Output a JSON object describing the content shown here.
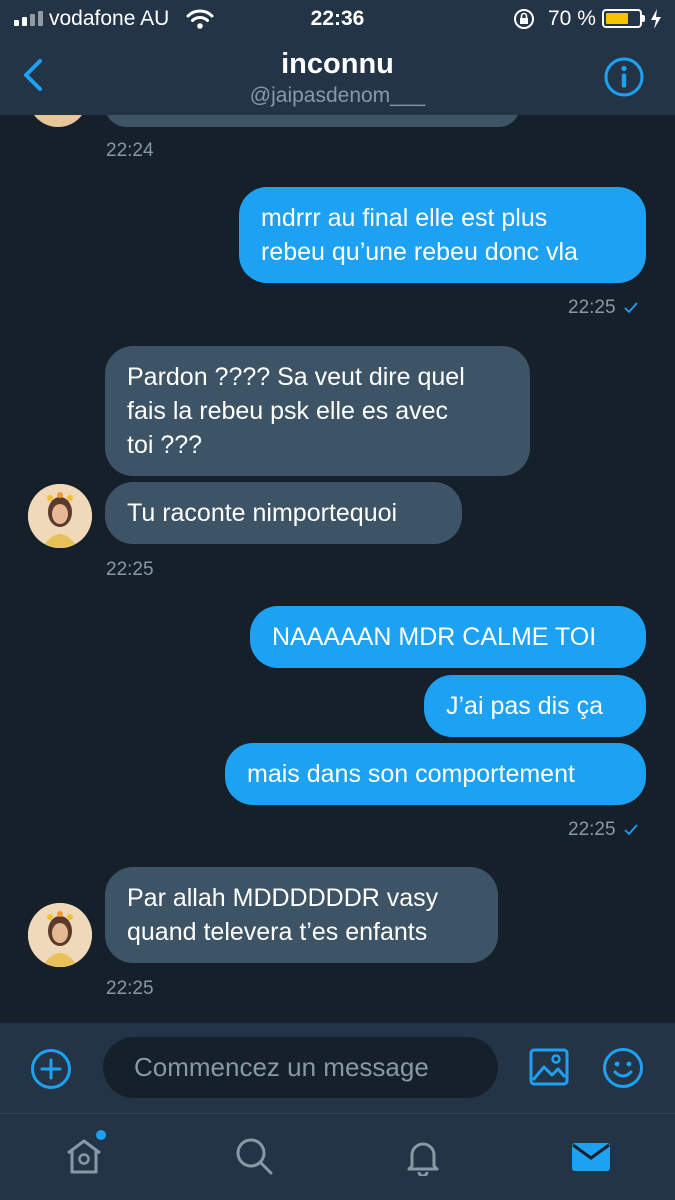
{
  "status_bar": {
    "carrier": "vodafone AU",
    "time": "22:36",
    "battery_percent": "70 %",
    "battery_level": 0.7
  },
  "header": {
    "title": "inconnu",
    "handle": "@jaipasdenom___"
  },
  "messages": [
    {
      "id": "m1",
      "side": "received",
      "text": "",
      "time": "22:24"
    },
    {
      "id": "m2",
      "side": "sent",
      "lines": [
        "mdrrr au final elle est plus",
        "rebeu qu’une rebeu donc vla"
      ],
      "time": "22:25",
      "read": true
    },
    {
      "id": "m3",
      "side": "received",
      "lines": [
        "Pardon ???? Sa veut dire quel",
        "fais la rebeu psk elle es avec",
        "toi ???"
      ]
    },
    {
      "id": "m4",
      "side": "received",
      "lines": [
        "Tu raconte nimportequoi"
      ],
      "time": "22:25"
    },
    {
      "id": "m5",
      "side": "sent",
      "lines": [
        "NAAAAAN MDR CALME TOI"
      ]
    },
    {
      "id": "m6",
      "side": "sent",
      "lines": [
        "J’ai pas dis ça"
      ]
    },
    {
      "id": "m7",
      "side": "sent",
      "lines": [
        "mais dans son comportement"
      ],
      "time": "22:25",
      "read": true
    },
    {
      "id": "m8",
      "side": "received",
      "lines": [
        "Par allah MDDDDDDR vasy",
        "quand televera t’es enfants"
      ],
      "time": "22:25"
    }
  ],
  "composer": {
    "placeholder": "Commencez un message"
  },
  "tabs": [
    {
      "name": "home",
      "icon": "home-icon",
      "has_badge": true
    },
    {
      "name": "search",
      "icon": "search-icon"
    },
    {
      "name": "notifications",
      "icon": "bell-icon"
    },
    {
      "name": "messages",
      "icon": "envelope-icon",
      "active": true
    }
  ],
  "colors": {
    "background": "#15202b",
    "bar": "#243447",
    "accent": "#1da1f2",
    "received_bubble": "#3d5466",
    "muted_text": "#8899a6",
    "battery_fill": "#f5c400"
  }
}
